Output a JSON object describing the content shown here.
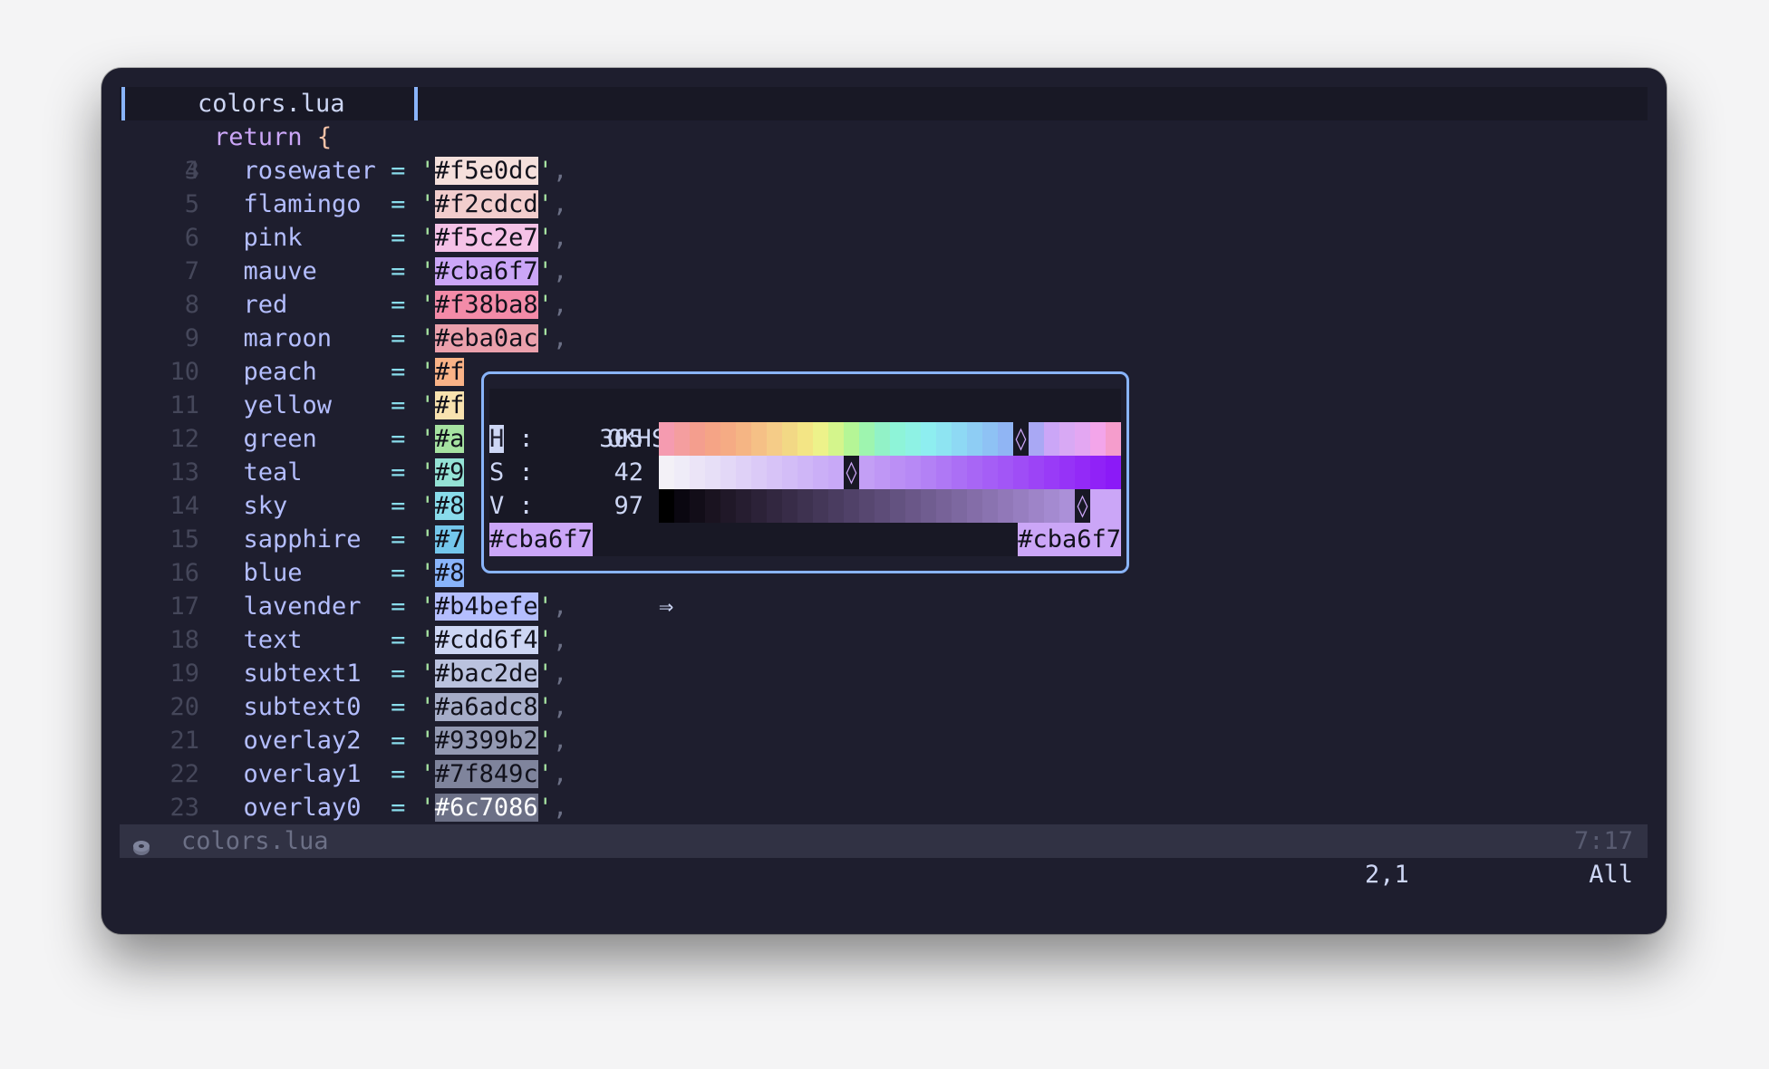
{
  "tab": {
    "label": "colors.lua"
  },
  "editor": {
    "opening_line": {
      "num": "3",
      "keyword": "return",
      "brace": "{"
    },
    "lines": [
      {
        "num": "4",
        "key": "rosewater",
        "pad": " ",
        "hex": "#f5e0dc",
        "color": "#f5e0dc",
        "fg": "#11111b",
        "shown": "#f5e0dc",
        "covered": false
      },
      {
        "num": "5",
        "key": "flamingo",
        "pad": "  ",
        "hex": "#f2cdcd",
        "color": "#f2cdcd",
        "fg": "#11111b",
        "shown": "#f2cdcd",
        "covered": false
      },
      {
        "num": "6",
        "key": "pink",
        "pad": "      ",
        "hex": "#f5c2e7",
        "color": "#f5c2e7",
        "fg": "#11111b",
        "shown": "#f5c2e7",
        "covered": false
      },
      {
        "num": "7",
        "key": "mauve",
        "pad": "     ",
        "hex": "#cba6f7",
        "color": "#cba6f7",
        "fg": "#11111b",
        "shown": "#cba6f7",
        "covered": false
      },
      {
        "num": "8",
        "key": "red",
        "pad": "       ",
        "hex": "#f38ba8",
        "color": "#f38ba8",
        "fg": "#11111b",
        "shown": "#f38ba8",
        "covered": false
      },
      {
        "num": "9",
        "key": "maroon",
        "pad": "    ",
        "hex": "#eba0ac",
        "color": "#eba0ac",
        "fg": "#11111b",
        "shown": "#eba0ac",
        "covered": false
      },
      {
        "num": "10",
        "key": "peach",
        "pad": "     ",
        "hex": "#f",
        "color": "#fab387",
        "fg": "#11111b",
        "shown": "#f",
        "covered": true
      },
      {
        "num": "11",
        "key": "yellow",
        "pad": "    ",
        "hex": "#f",
        "color": "#f9e2af",
        "fg": "#11111b",
        "shown": "#f",
        "covered": true
      },
      {
        "num": "12",
        "key": "green",
        "pad": "     ",
        "hex": "#a",
        "color": "#a6e3a1",
        "fg": "#11111b",
        "shown": "#a",
        "covered": true
      },
      {
        "num": "13",
        "key": "teal",
        "pad": "      ",
        "hex": "#9",
        "color": "#94e2d5",
        "fg": "#11111b",
        "shown": "#9",
        "covered": true
      },
      {
        "num": "14",
        "key": "sky",
        "pad": "       ",
        "hex": "#8",
        "color": "#89dceb",
        "fg": "#11111b",
        "shown": "#8",
        "covered": true
      },
      {
        "num": "15",
        "key": "sapphire",
        "pad": "  ",
        "hex": "#7",
        "color": "#74c7ec",
        "fg": "#11111b",
        "shown": "#7",
        "covered": true
      },
      {
        "num": "16",
        "key": "blue",
        "pad": "      ",
        "hex": "#8",
        "color": "#89b4fa",
        "fg": "#11111b",
        "shown": "#8",
        "covered": true
      },
      {
        "num": "17",
        "key": "lavender",
        "pad": "  ",
        "hex": "#b4befe",
        "color": "#b4befe",
        "fg": "#11111b",
        "shown": "#b4befe",
        "covered": false
      },
      {
        "num": "18",
        "key": "text",
        "pad": "      ",
        "hex": "#cdd6f4",
        "color": "#cdd6f4",
        "fg": "#11111b",
        "shown": "#cdd6f4",
        "covered": false
      },
      {
        "num": "19",
        "key": "subtext1",
        "pad": "  ",
        "hex": "#bac2de",
        "color": "#bac2de",
        "fg": "#11111b",
        "shown": "#bac2de",
        "covered": false
      },
      {
        "num": "20",
        "key": "subtext0",
        "pad": "  ",
        "hex": "#a6adc8",
        "color": "#a6adc8",
        "fg": "#11111b",
        "shown": "#a6adc8",
        "covered": false
      },
      {
        "num": "21",
        "key": "overlay2",
        "pad": "  ",
        "hex": "#9399b2",
        "color": "#9399b2",
        "fg": "#11111b",
        "shown": "#9399b2",
        "covered": false
      },
      {
        "num": "22",
        "key": "overlay1",
        "pad": "  ",
        "hex": "#7f849c",
        "color": "#7f849c",
        "fg": "#11111b",
        "shown": "#7f849c",
        "covered": false
      },
      {
        "num": "23",
        "key": "overlay0",
        "pad": "  ",
        "hex": "#6c7086",
        "color": "#6c7086",
        "fg": "#ffffff",
        "shown": "#6c7086",
        "covered": false
      }
    ],
    "eq": "=",
    "quote": "'",
    "comma": ","
  },
  "popup": {
    "title": "OKHSV",
    "sliders": [
      {
        "name": "hue",
        "label": "H",
        "value": "305",
        "marker_fraction": 0.8,
        "highlighted": true
      },
      {
        "name": "saturation",
        "label": "S",
        "value": "42",
        "marker_fraction": 0.4,
        "highlighted": false
      },
      {
        "name": "value",
        "label": "V",
        "value": "97",
        "marker_fraction": 0.93,
        "highlighted": false
      }
    ],
    "separator": ":",
    "marker_glyph": "◊",
    "hue_gradient": [
      "#f59bb0",
      "#f49e9f",
      "#f49e8e",
      "#f5a486",
      "#f5ab84",
      "#f5b584",
      "#f5c086",
      "#f5cc88",
      "#f2d885",
      "#f3e585",
      "#edf28a",
      "#d4f58c",
      "#b5f696",
      "#9ef5af",
      "#92f2c7",
      "#8ef4d8",
      "#8ef2e4",
      "#8eeef0",
      "#8ee4f2",
      "#8ed9f4",
      "#8ecdf4",
      "#8ec2f4",
      "#90b5f4",
      "#99acf4",
      "#a9a8f4",
      "#cba6f7",
      "#d8a9f4",
      "#e3a7f2",
      "#f3a5ea",
      "#f59dcc",
      "#f59bb8"
    ],
    "sat_gradient": [
      "#f3f1f7",
      "#efecf8",
      "#ebe4f7",
      "#e7dff7",
      "#e3d8f7",
      "#dfd1f7",
      "#dbcaf7",
      "#d7c3f7",
      "#d3bdf7",
      "#cfb6f7",
      "#cbaff7",
      "#c8a9f7",
      "#cba6f7",
      "#c39ff5",
      "#bf97f5",
      "#bb8ff5",
      "#b789f5",
      "#b381f5",
      "#af78f5",
      "#ab6ff5",
      "#a866f5",
      "#a55ef6",
      "#a256f6",
      "#9f4df6",
      "#9c44f6",
      "#993bf7",
      "#9633f7",
      "#932af7",
      "#9022f7",
      "#8b1af7"
    ],
    "val_gradient": [
      "#000000",
      "#0a0710",
      "#120d18",
      "#1a1320",
      "#201828",
      "#261d30",
      "#2c2238",
      "#322740",
      "#382c48",
      "#3e3250",
      "#443758",
      "#4a3c60",
      "#504168",
      "#574770",
      "#5d4c78",
      "#635280",
      "#6a5788",
      "#705d90",
      "#776298",
      "#7d68a0",
      "#846da8",
      "#8a73b0",
      "#9178b8",
      "#977ec0",
      "#9e84c8",
      "#a48ad0",
      "#ab90d8",
      "#b296e0",
      "#cba6f7",
      "#cba6f7"
    ],
    "from_hex": "#cba6f7",
    "arrow": "⇒",
    "to_hex": "#cba6f7",
    "swatch_color": "#cba6f7"
  },
  "statusline": {
    "icon": "donut-icon",
    "filename": "colors.lua",
    "position": "7:17"
  },
  "cmdline": {
    "cursor_position": "2,1",
    "scroll": "All"
  }
}
